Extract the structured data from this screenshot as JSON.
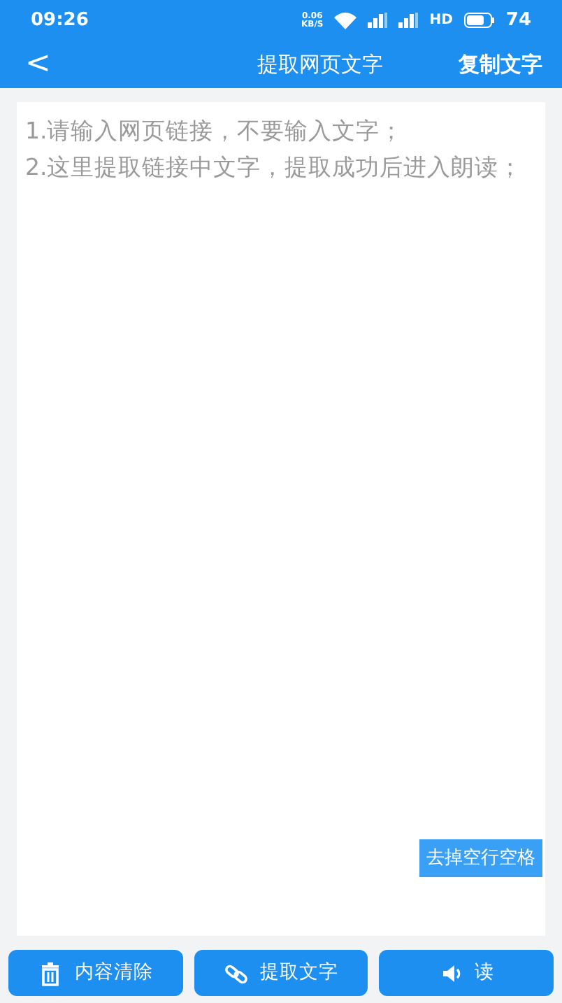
{
  "status_bar": {
    "time": "09:26",
    "net_speed": "0.06\nKB/S",
    "network": "HD",
    "battery": "74"
  },
  "nav": {
    "back": "<",
    "title": "提取网页文字",
    "action": "复制文字"
  },
  "editor": {
    "placeholder": "1.请输入网页链接，不要输入文字；\n2.这里提取链接中文字，提取成功后进入朗读；",
    "tool_button": "去掉空行空格"
  },
  "buttons": [
    {
      "kind": "clear",
      "label": "内容清除"
    },
    {
      "kind": "link",
      "label": "提取文字"
    },
    {
      "kind": "read",
      "label": "读"
    }
  ]
}
